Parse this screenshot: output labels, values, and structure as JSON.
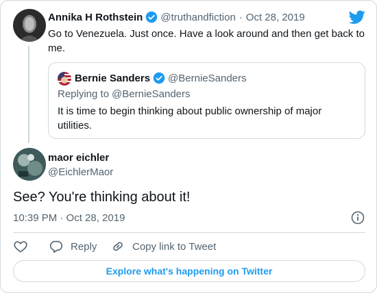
{
  "reply_to_tweet": {
    "author_name": "Annika H Rothstein",
    "handle": "@truthandfiction",
    "separator": "·",
    "date": "Oct 28, 2019",
    "text": "Go to Venezuela. Just once. Have a look around and then get back to me."
  },
  "quoted_tweet": {
    "author_name": "Bernie Sanders",
    "handle": "@BernieSanders",
    "replying_to_label": "Replying to",
    "replying_to_handle": "@BernieSanders",
    "text": "It is time to begin thinking about public ownership of major utilities."
  },
  "main_tweet": {
    "author_name": "maor eichler",
    "handle": "@EichlerMaor",
    "text": "See? You're thinking about it!",
    "timestamp": "10:39 PM · Oct 28, 2019"
  },
  "actions": {
    "reply_label": "Reply",
    "copy_link_label": "Copy link to Tweet"
  },
  "explore_label": "Explore what's happening on Twitter",
  "colors": {
    "accent": "#1d9bf0",
    "border": "#cfd9de",
    "muted_text": "#536471",
    "text": "#0f1419"
  },
  "icons": [
    "twitter-bird-icon",
    "verified-badge-icon",
    "info-icon",
    "heart-icon",
    "reply-icon",
    "link-icon"
  ]
}
